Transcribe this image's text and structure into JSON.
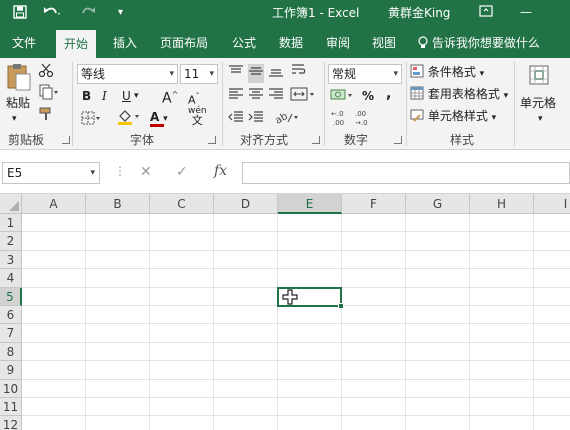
{
  "app": {
    "title": "工作簿1 - Excel",
    "user": "黄群金King"
  },
  "quick_access": {
    "save_icon": "save-icon",
    "undo_icon": "undo-icon",
    "redo_icon": "redo-icon",
    "customize_icon": "customize-icon"
  },
  "tabs": [
    "文件",
    "开始",
    "插入",
    "页面布局",
    "公式",
    "数据",
    "审阅",
    "视图"
  ],
  "active_tab": "开始",
  "tellme": "告诉我你想要做什么",
  "ribbon": {
    "clipboard": {
      "label": "剪贴板",
      "paste": "粘贴"
    },
    "font": {
      "label": "字体",
      "font_name": "等线",
      "font_size": "11",
      "bold": "B",
      "italic": "I",
      "underline": "U",
      "grow": "A",
      "shrink": "A",
      "font_color_letter": "A",
      "wen": "wén"
    },
    "alignment": {
      "label": "对齐方式"
    },
    "number": {
      "label": "数字",
      "format": "常规",
      "percent": "%",
      "comma": ","
    },
    "styles": {
      "label": "样式",
      "conditional": "条件格式",
      "table": "套用表格格式",
      "cell": "单元格样式"
    },
    "cells": {
      "label": "单元格"
    }
  },
  "formula_bar": {
    "name_box": "E5",
    "cancel": "✕",
    "enter": "✓",
    "fx": "fx",
    "value": ""
  },
  "sheet": {
    "columns": [
      "A",
      "B",
      "C",
      "D",
      "E",
      "F",
      "G",
      "H",
      "I"
    ],
    "rows": [
      "1",
      "2",
      "3",
      "4",
      "5",
      "6",
      "7",
      "8",
      "9",
      "10",
      "11",
      "12"
    ],
    "selected_column": "E",
    "selected_row": "5"
  },
  "colors": {
    "accent": "#217346",
    "ribbon_bg": "#f3f3f3",
    "header_bg": "#e6e6e6",
    "grid_line": "#e2e2e2"
  }
}
